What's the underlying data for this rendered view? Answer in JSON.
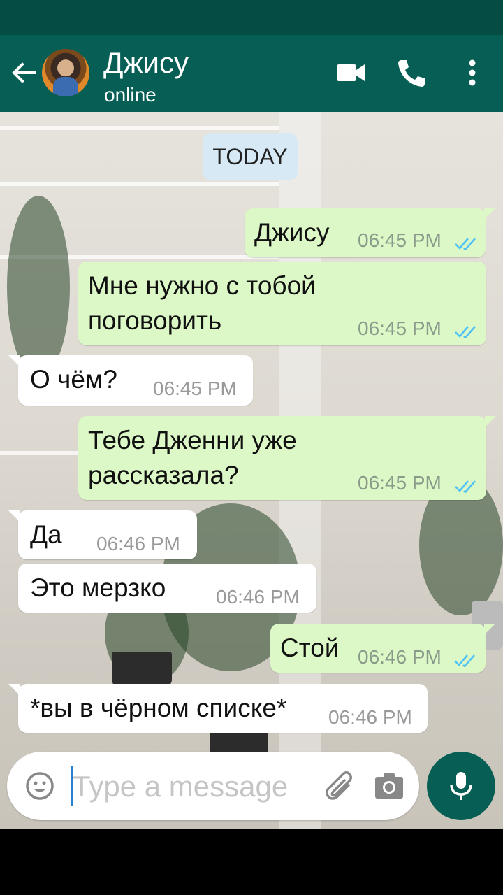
{
  "header": {
    "contact_name": "Джису",
    "status": "online",
    "icons": [
      "back-arrow-icon",
      "video-call-icon",
      "phone-icon",
      "more-vert-icon"
    ]
  },
  "chat": {
    "date_label": "TODAY",
    "messages": [
      {
        "direction": "outgoing",
        "text": "Джису",
        "time": "06:45 PM",
        "read": true
      },
      {
        "direction": "outgoing",
        "text": "Мне нужно с тобой\nпоговорить",
        "time": "06:45 PM",
        "read": true
      },
      {
        "direction": "incoming",
        "text": "О чём?",
        "time": "06:45 PM"
      },
      {
        "direction": "outgoing",
        "text": "Тебе Дженни уже\nрассказала?",
        "time": "06:45 PM",
        "read": true
      },
      {
        "direction": "incoming",
        "text": "Да",
        "time": "06:46 PM"
      },
      {
        "direction": "incoming",
        "text": "Это мерзко",
        "time": "06:46 PM"
      },
      {
        "direction": "outgoing",
        "text": "Стой",
        "time": "06:46 PM",
        "read": true
      },
      {
        "direction": "incoming",
        "text": "*вы в чёрном списке*",
        "time": "06:46 PM"
      }
    ]
  },
  "composer": {
    "placeholder": "Type a message",
    "icons": [
      "emoji-icon",
      "attach-icon",
      "camera-icon",
      "mic-icon"
    ]
  },
  "colors": {
    "header": "#075e54",
    "outgoing_bubble": "#dcf8c6",
    "incoming_bubble": "#ffffff",
    "read_tick": "#4fc3f7"
  }
}
